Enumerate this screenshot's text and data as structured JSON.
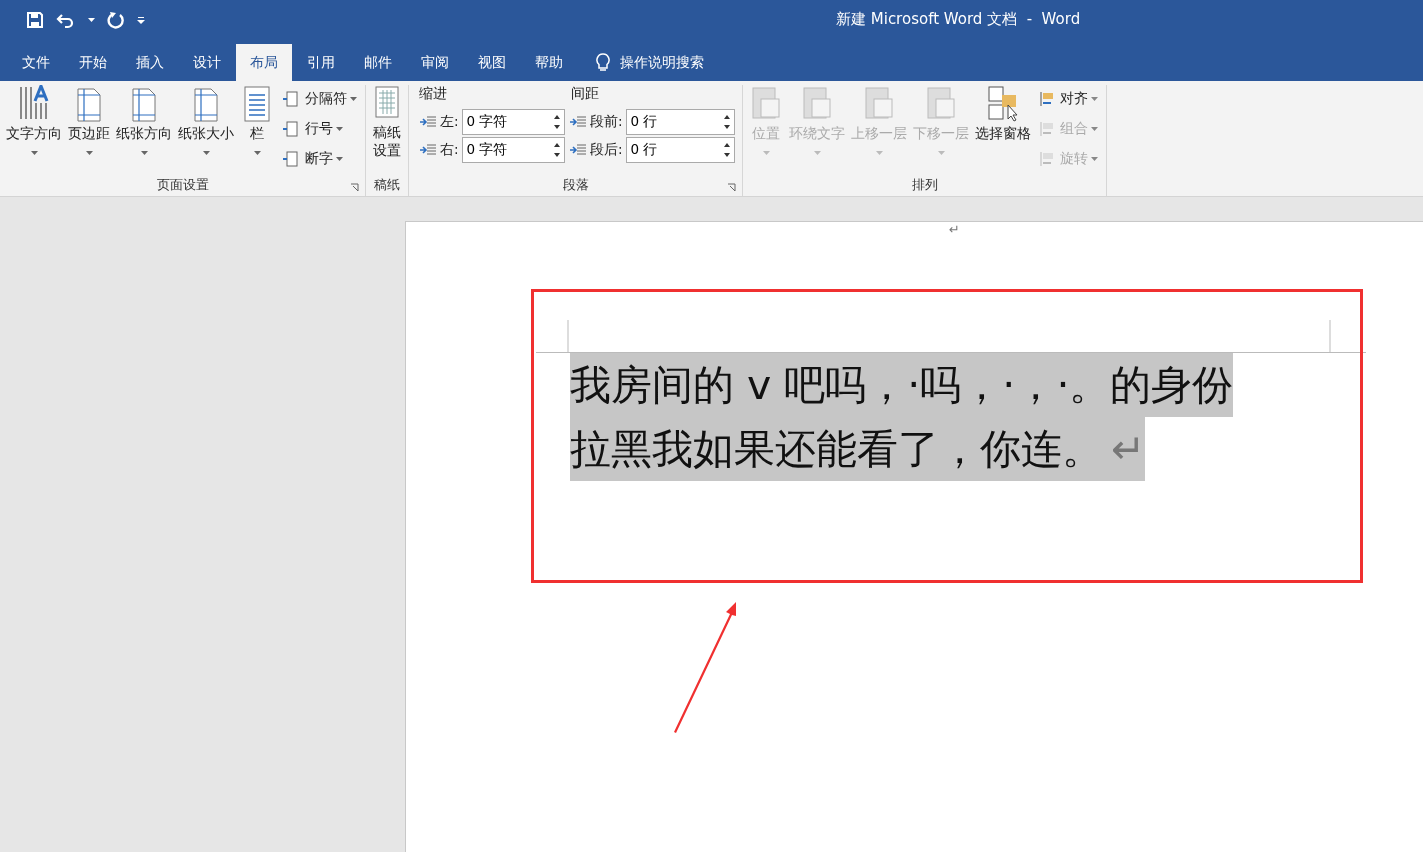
{
  "window": {
    "title": "新建 Microsoft Word 文档  -  Word"
  },
  "tabs": [
    {
      "label": "文件",
      "selected": false
    },
    {
      "label": "开始",
      "selected": false
    },
    {
      "label": "插入",
      "selected": false
    },
    {
      "label": "设计",
      "selected": false
    },
    {
      "label": "布局",
      "selected": true
    },
    {
      "label": "引用",
      "selected": false
    },
    {
      "label": "邮件",
      "selected": false
    },
    {
      "label": "审阅",
      "selected": false
    },
    {
      "label": "视图",
      "selected": false
    },
    {
      "label": "帮助",
      "selected": false
    }
  ],
  "tell_me": "操作说明搜索",
  "ribbon": {
    "page_setup": {
      "label": "页面设置",
      "large": [
        {
          "label": "文字方向"
        },
        {
          "label": "页边距"
        },
        {
          "label": "纸张方向"
        },
        {
          "label": "纸张大小"
        },
        {
          "label": "栏"
        }
      ],
      "small": [
        {
          "label": "分隔符"
        },
        {
          "label": "行号"
        },
        {
          "label": "断字"
        }
      ]
    },
    "manuscript": {
      "label": "稿纸",
      "button": "稿纸设置"
    },
    "paragraph": {
      "label": "段落",
      "indent_heading": "缩进",
      "spacing_heading": "间距",
      "fields": [
        {
          "label": "左:",
          "value": "0 字符"
        },
        {
          "label": "段前:",
          "value": "0 行"
        },
        {
          "label": "右:",
          "value": "0 字符"
        },
        {
          "label": "段后:",
          "value": "0 行"
        }
      ]
    },
    "arrange": {
      "label": "排列",
      "large": [
        {
          "label": "位置",
          "disabled": true
        },
        {
          "label": "环绕文字",
          "disabled": true
        },
        {
          "label": "上移一层",
          "disabled": true
        },
        {
          "label": "下移一层",
          "disabled": true
        },
        {
          "label": "选择窗格",
          "disabled": false
        }
      ],
      "small": [
        {
          "label": "对齐",
          "disabled": false
        },
        {
          "label": "组合",
          "disabled": true
        },
        {
          "label": "旋转",
          "disabled": true
        }
      ]
    }
  },
  "document": {
    "header_mark": "↵",
    "lines": [
      "我房间的 v 吧吗，·吗，·，·。的身份",
      "拉黑我如果还能看了，你连。"
    ],
    "paragraph_mark": "↵",
    "selected": true
  }
}
